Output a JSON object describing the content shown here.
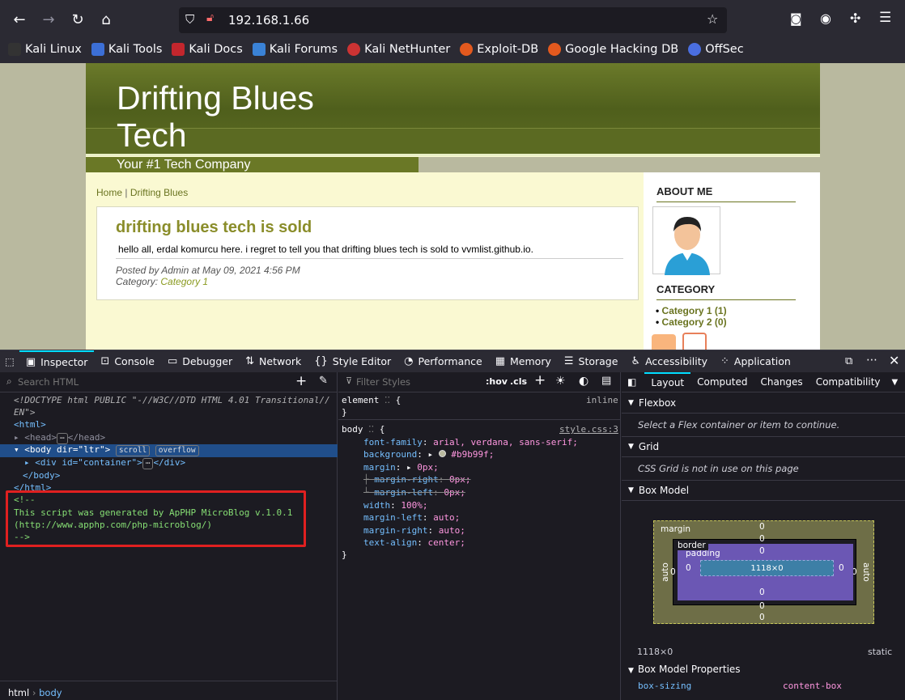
{
  "browser": {
    "url": "192.168.1.66",
    "bookmarks": [
      "Kali Linux",
      "Kali Tools",
      "Kali Docs",
      "Kali Forums",
      "Kali NetHunter",
      "Exploit-DB",
      "Google Hacking DB",
      "OffSec"
    ]
  },
  "site": {
    "title": "Drifting Blues Tech",
    "slogan": "Your #1 Tech Company",
    "breadcrumb_home": "Home",
    "breadcrumb_sep": "|",
    "breadcrumb_current": "Drifting Blues",
    "post": {
      "title": "drifting blues tech is sold",
      "body": "hello all, erdal komurcu here. i regret to tell you that drifting blues tech is sold to vvmlist.github.io.",
      "meta": "Posted by Admin at May 09, 2021 4:56 PM",
      "category_label": "Category:",
      "category_value": "Category 1"
    },
    "sidebar": {
      "about_heading": "ABOUT ME",
      "category_heading": "CATEGORY",
      "categories": [
        "Category 1 (1)",
        "Category 2 (0)"
      ]
    }
  },
  "devtools": {
    "tabs": [
      "Inspector",
      "Console",
      "Debugger",
      "Network",
      "Style Editor",
      "Performance",
      "Memory",
      "Storage",
      "Accessibility",
      "Application"
    ],
    "search_placeholder": "Search HTML",
    "filter_placeholder": "Filter Styles",
    "hov": ":hov",
    "cls": ".cls",
    "html_lines": {
      "doctype1": "<!DOCTYPE html PUBLIC \"-//W3C//DTD HTML 4.01 Transitional//",
      "doctype2": "EN\">",
      "html_open": "<html>",
      "head": "<head>",
      "head_close": "</head>",
      "body_open": "<body dir=\"ltr\">",
      "scroll_badge": "scroll",
      "overflow_badge": "overflow",
      "div": "<div id=\"container\">",
      "div_close": "</div>",
      "body_close": "</body>",
      "html_close": "</html>",
      "comment1": "<!--",
      "comment2": "This script was generated by ApPHP MicroBlog v.1.0.1",
      "comment3": "(http://www.apphp.com/php-microblog/)",
      "comment4": "-->"
    },
    "rules": {
      "element_selector": "element",
      "element_src": "inline",
      "body_selector": "body",
      "body_src": "style.css:3",
      "decls": [
        {
          "p": "font-family",
          "v": "arial, verdana, sans-serif;"
        },
        {
          "p": "background",
          "v": "#b9b99f;"
        },
        {
          "p": "margin",
          "v": "0px;"
        },
        {
          "p": "margin-right",
          "v": "0px;"
        },
        {
          "p": "margin-left",
          "v": "0px;"
        },
        {
          "p": "width",
          "v": "100%;"
        },
        {
          "p": "margin-left",
          "v": "auto;"
        },
        {
          "p": "margin-right",
          "v": "auto;"
        },
        {
          "p": "text-align",
          "v": "center;"
        }
      ]
    },
    "layout_tabs": [
      "Layout",
      "Computed",
      "Changes",
      "Compatibility"
    ],
    "flexbox_heading": "Flexbox",
    "flexbox_note": "Select a Flex container or item to continue.",
    "grid_heading": "Grid",
    "grid_note": "CSS Grid is not in use on this page",
    "boxmodel_heading": "Box Model",
    "boxmodel": {
      "margin_label": "margin",
      "border_label": "border",
      "padding_label": "padding",
      "content": "1118×0",
      "auto": "auto",
      "zero": "0"
    },
    "size": "1118×0",
    "position": "static",
    "props_heading": "Box Model Properties",
    "prop_name": "box-sizing",
    "prop_value": "content-box",
    "breadcrumb": [
      "html",
      "body"
    ]
  },
  "colors": {
    "accent": "#00ddff",
    "highlight_red": "#e02020",
    "selected_row": "#204e8a"
  }
}
